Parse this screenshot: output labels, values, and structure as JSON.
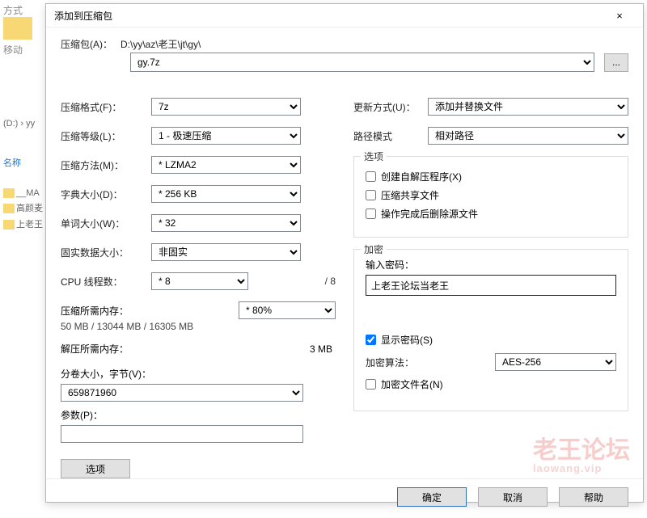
{
  "background": {
    "mode": "方式",
    "move": "移动",
    "breadcrumb": "(D:) › yy",
    "name_header": "名称",
    "items": [
      "__MA",
      "高颜麦",
      "上老王"
    ]
  },
  "dialog": {
    "title": "添加到压缩包",
    "close": "×",
    "archive_label": "压缩包(A)：",
    "archive_path": "D:\\yy\\az\\老王\\jt\\gy\\",
    "archive_name": "gy.7z",
    "browse": "...",
    "left": {
      "format_label": "压缩格式(F)：",
      "format_value": "7z",
      "level_label": "压缩等级(L)：",
      "level_value": "1 - 极速压缩",
      "method_label": "压缩方法(M)：",
      "method_value": "* LZMA2",
      "dict_label": "字典大小(D)：",
      "dict_value": "* 256 KB",
      "word_label": "单词大小(W)：",
      "word_value": "* 32",
      "solid_label": "固实数据大小：",
      "solid_value": "非固实",
      "threads_label": "CPU 线程数：",
      "threads_value": "* 8",
      "threads_max": "/ 8",
      "mem_comp_label": "压缩所需内存：",
      "mem_comp_usage": "* 80%",
      "mem_comp_detail": "50 MB / 13044 MB / 16305 MB",
      "mem_decomp_label": "解压所需内存：",
      "mem_decomp_value": "3 MB",
      "volume_label": "分卷大小，字节(V)：",
      "volume_value": "659871960",
      "params_label": "参数(P)：",
      "params_value": "",
      "options_btn": "选项"
    },
    "right": {
      "update_label": "更新方式(U)：",
      "update_value": "添加并替换文件",
      "pathmode_label": "路径模式",
      "pathmode_value": "相对路径",
      "options_title": "选项",
      "opt_sfx": "创建自解压程序(X)",
      "opt_share": "压缩共享文件",
      "opt_delete": "操作完成后删除源文件",
      "encrypt_title": "加密",
      "pwd_label": "输入密码：",
      "pwd_value": "上老王论坛当老王",
      "show_pwd": "显示密码(S)",
      "method_label": "加密算法：",
      "method_value": "AES-256",
      "encrypt_names": "加密文件名(N)"
    },
    "buttons": {
      "ok": "确定",
      "cancel": "取消",
      "help": "帮助"
    }
  },
  "watermark": {
    "main": "老王论坛",
    "sub": "laowang.vip"
  }
}
